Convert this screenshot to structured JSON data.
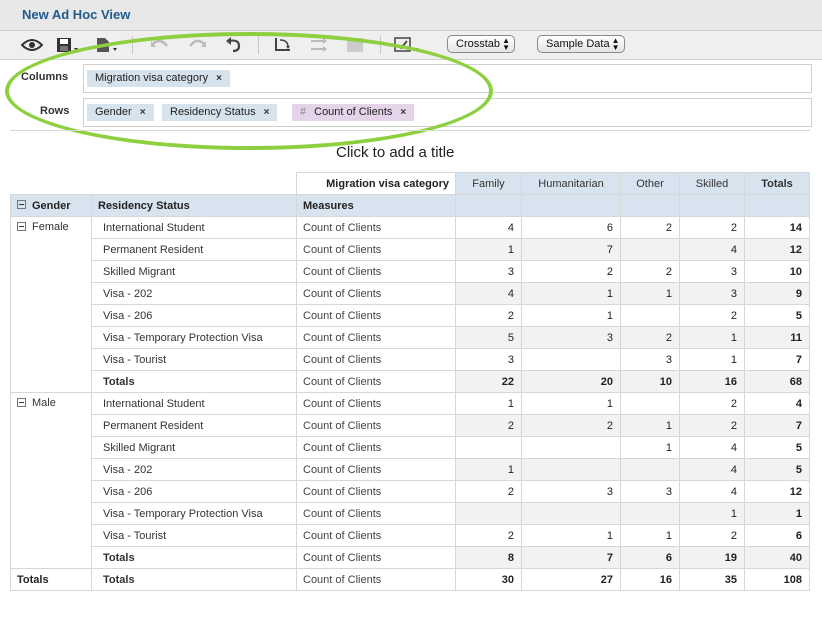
{
  "window": {
    "title": "New Ad Hoc View"
  },
  "toolbar": {
    "view_select": "Crosstab",
    "data_select": "Sample Data",
    "icons": [
      "eye-icon",
      "save-icon",
      "export-icon",
      "undo-icon",
      "redo-icon",
      "undo-all-icon",
      "pivot-icon",
      "switch-icon",
      "sort-icon",
      "chart-options-icon"
    ]
  },
  "layout": {
    "columns_label": "Columns",
    "rows_label": "Rows",
    "column_fields": [
      "Migration visa category"
    ],
    "row_fields": [
      "Gender",
      "Residency Status"
    ],
    "measure_fields": [
      "Count of Clients"
    ],
    "measure_symbol": "#",
    "remove_symbol": "×"
  },
  "report": {
    "title_placeholder": "Click to add a title",
    "column_dimension_header": "Migration visa category",
    "row_headers": [
      "Gender",
      "Residency Status",
      "Measures"
    ],
    "columns": [
      "Family",
      "Humanitarian",
      "Other",
      "Skilled",
      "Totals"
    ],
    "groups": [
      {
        "name": "Female",
        "rows": [
          {
            "label": "International Student",
            "measure": "Count of Clients",
            "values": [
              "4",
              "6",
              "2",
              "2",
              "14"
            ]
          },
          {
            "label": "Permanent Resident",
            "measure": "Count of Clients",
            "values": [
              "1",
              "7",
              "",
              "4",
              "12"
            ]
          },
          {
            "label": "Skilled Migrant",
            "measure": "Count of Clients",
            "values": [
              "3",
              "2",
              "2",
              "3",
              "10"
            ]
          },
          {
            "label": "Visa - 202",
            "measure": "Count of Clients",
            "values": [
              "4",
              "1",
              "1",
              "3",
              "9"
            ]
          },
          {
            "label": "Visa - 206",
            "measure": "Count of Clients",
            "values": [
              "2",
              "1",
              "",
              "2",
              "5"
            ]
          },
          {
            "label": "Visa - Temporary Protection Visa",
            "measure": "Count of Clients",
            "values": [
              "5",
              "3",
              "2",
              "1",
              "11"
            ]
          },
          {
            "label": "Visa - Tourist",
            "measure": "Count of Clients",
            "values": [
              "3",
              "",
              "3",
              "1",
              "7"
            ]
          }
        ],
        "totals": {
          "label": "Totals",
          "measure": "Count of Clients",
          "values": [
            "22",
            "20",
            "10",
            "16",
            "68"
          ]
        }
      },
      {
        "name": "Male",
        "rows": [
          {
            "label": "International Student",
            "measure": "Count of Clients",
            "values": [
              "1",
              "1",
              "",
              "2",
              "4"
            ]
          },
          {
            "label": "Permanent Resident",
            "measure": "Count of Clients",
            "values": [
              "2",
              "2",
              "1",
              "2",
              "7"
            ]
          },
          {
            "label": "Skilled Migrant",
            "measure": "Count of Clients",
            "values": [
              "",
              "",
              "1",
              "4",
              "5"
            ]
          },
          {
            "label": "Visa - 202",
            "measure": "Count of Clients",
            "values": [
              "1",
              "",
              "",
              "4",
              "5"
            ]
          },
          {
            "label": "Visa - 206",
            "measure": "Count of Clients",
            "values": [
              "2",
              "3",
              "3",
              "4",
              "12"
            ]
          },
          {
            "label": "Visa - Temporary Protection Visa",
            "measure": "Count of Clients",
            "values": [
              "",
              "",
              "",
              "1",
              "1"
            ]
          },
          {
            "label": "Visa - Tourist",
            "measure": "Count of Clients",
            "values": [
              "2",
              "1",
              "1",
              "2",
              "6"
            ]
          }
        ],
        "totals": {
          "label": "Totals",
          "measure": "Count of Clients",
          "values": [
            "8",
            "7",
            "6",
            "19",
            "40"
          ]
        }
      }
    ],
    "grand_total": {
      "label": "Totals",
      "sublabel": "Totals",
      "measure": "Count of Clients",
      "values": [
        "30",
        "27",
        "16",
        "35",
        "108"
      ]
    }
  },
  "colors": {
    "accent": "#1f5a8f",
    "header_bg": "#d7e3ee",
    "highlight_ellipse": "#8dcf3f",
    "measure_pill": "#e5d3ea"
  }
}
